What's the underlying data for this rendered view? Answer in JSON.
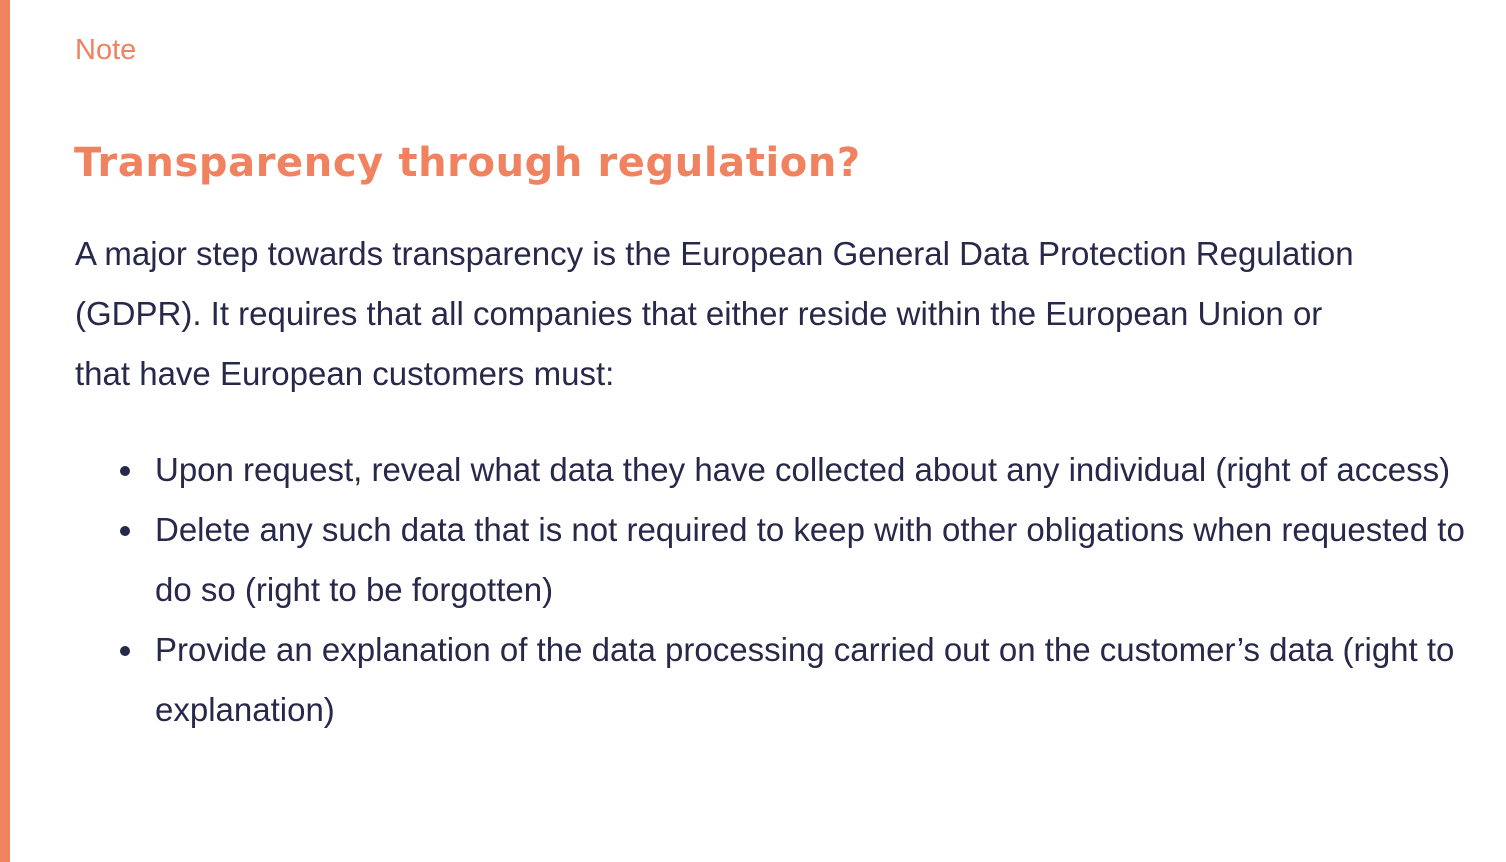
{
  "note": {
    "label": "Note",
    "title": "Transparency through regulation?",
    "intro": "A major step towards transparency is the European General Data Protection Regulation (GDPR). It requires that all companies that either reside within the European Union or that have European customers must:",
    "bullets": [
      "Upon request, reveal what data they have collected about any individual (right of access)",
      "Delete any such data that is not required to keep with other obligations when requested to do so (right to be forgotten)",
      "Provide an explanation of the data processing carried out on the customer’s data (right to explanation)"
    ],
    "accent_color": "#f08260",
    "text_color": "#27284a"
  }
}
